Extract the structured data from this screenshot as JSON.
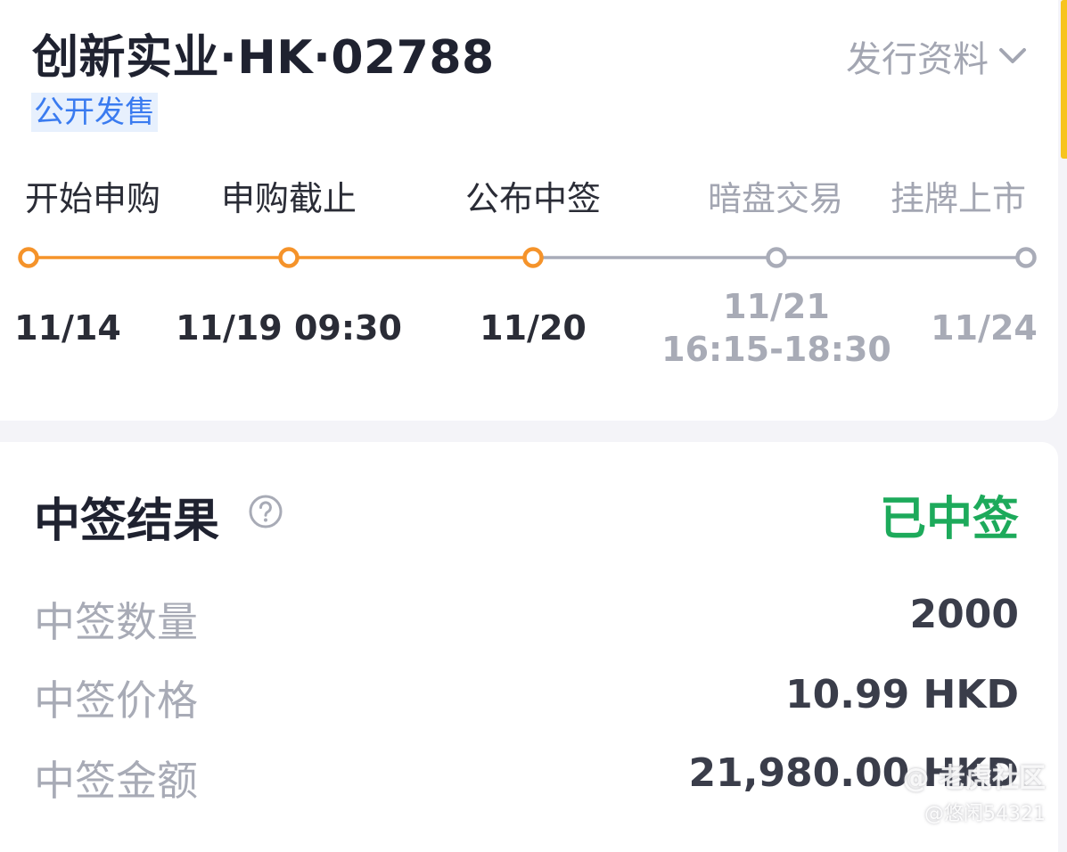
{
  "header": {
    "stock_title": "创新实业·HK·02788",
    "status_tag": "公开发售",
    "prospectus_label": "发行资料"
  },
  "timeline": {
    "steps": [
      {
        "label": "开始申购",
        "date_line1": "11/14",
        "date_line2": "",
        "state": "done"
      },
      {
        "label": "申购截止",
        "date_line1": "11/19 09:30",
        "date_line2": "",
        "state": "done"
      },
      {
        "label": "公布中签",
        "date_line1": "11/20",
        "date_line2": "",
        "state": "current"
      },
      {
        "label": "暗盘交易",
        "date_line1": "11/21",
        "date_line2": "16:15-18:30",
        "state": "todo"
      },
      {
        "label": "挂牌上市",
        "date_line1": "11/24",
        "date_line2": "",
        "state": "todo"
      }
    ],
    "colors": {
      "done": "#f5932a",
      "todo": "#a9acb8"
    }
  },
  "result": {
    "title": "中签结果",
    "status": "已中签",
    "rows": [
      {
        "label": "中签数量",
        "value": "2000"
      },
      {
        "label": "中签价格",
        "value": "10.99 HKD"
      },
      {
        "label": "中签金额",
        "value": "21,980.00 HKD"
      }
    ]
  },
  "watermark": {
    "brand": "@ 老虎社区",
    "user": "@悠闲54321"
  },
  "colors": {
    "accent": "#f5932a",
    "success": "#1daa5b",
    "link": "#3a7bf0",
    "scroll_accent": "#f7c41f"
  }
}
